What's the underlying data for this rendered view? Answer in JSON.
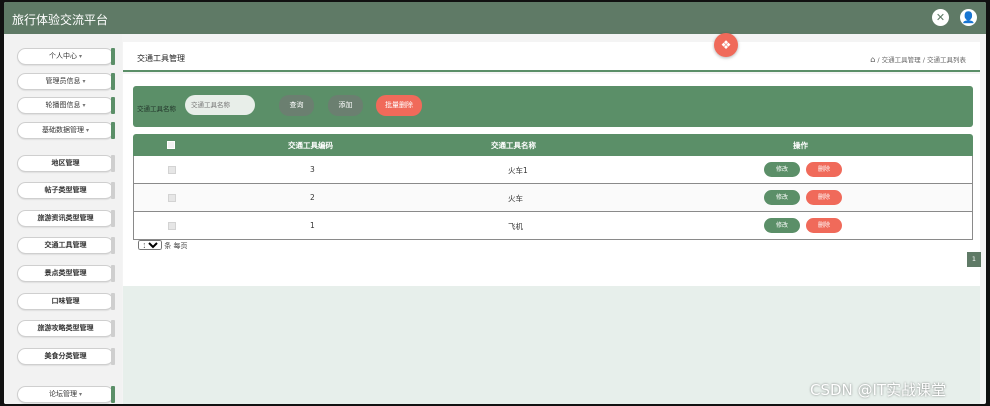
{
  "header": {
    "app_title": "旅行体验交流平台"
  },
  "sidebar": {
    "items": [
      {
        "label": "个人中心"
      },
      {
        "label": "管理员信息"
      },
      {
        "label": "轮播图信息"
      },
      {
        "label": "基础数据管理"
      },
      {
        "label": "地区管理"
      },
      {
        "label": "帖子类型管理"
      },
      {
        "label": "旅游资讯类型管理"
      },
      {
        "label": "交通工具管理"
      },
      {
        "label": "景点类型管理"
      },
      {
        "label": "口味管理"
      },
      {
        "label": "旅游攻略类型管理"
      },
      {
        "label": "美食分类管理"
      },
      {
        "label": "论坛管理"
      }
    ]
  },
  "page": {
    "title": "交通工具管理",
    "breadcrumb": [
      "交通工具管理",
      "交通工具列表"
    ]
  },
  "search": {
    "label": "交通工具名称",
    "placeholder": "交通工具名称",
    "query_btn": "查询",
    "add_btn": "添加",
    "batch_delete_btn": "批量删除"
  },
  "table": {
    "columns": [
      "交通工具编码",
      "交通工具名称",
      "操作"
    ],
    "rows": [
      {
        "code": "3",
        "name": "火车1"
      },
      {
        "code": "2",
        "name": "火车"
      },
      {
        "code": "1",
        "name": "飞机"
      }
    ],
    "edit_label": "修改",
    "delete_label": "删除"
  },
  "pagination": {
    "page_size": "10",
    "per_page_suffix": "条 每页",
    "current_page": "1"
  },
  "watermark": "CSDN @IT实战课堂",
  "colors": {
    "topbar": "#5f7a66",
    "accent": "#5b8f68",
    "danger": "#f06a5a"
  }
}
